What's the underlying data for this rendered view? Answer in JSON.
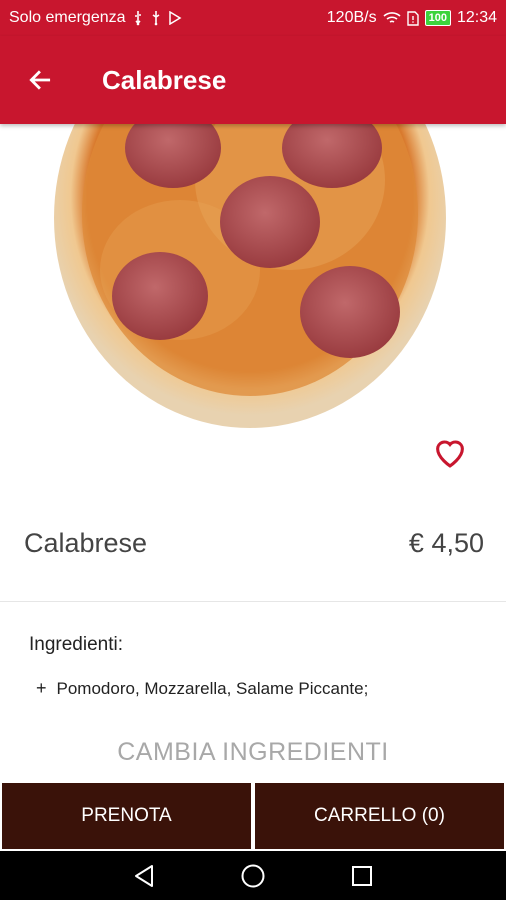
{
  "status_bar": {
    "carrier": "Solo emergenza",
    "speed": "120B/s",
    "battery": "100",
    "time": "12:34"
  },
  "app_bar": {
    "title": "Calabrese",
    "back_icon": "arrow-left-icon"
  },
  "product": {
    "name": "Calabrese",
    "price": "€ 4,50",
    "favorite_icon": "heart-outline-icon",
    "accent_color": "#c8162e"
  },
  "ingredients": {
    "title": "Ingredienti:",
    "items": [
      {
        "prefix": "+",
        "text": "Pomodoro, Mozzarella, Salame Piccante;"
      }
    ]
  },
  "change_ingredients_label": "CAMBIA INGREDIENTI",
  "buttons": {
    "book": "PRENOTA",
    "cart": "CARRELLO (0)",
    "color": "#3a1209"
  },
  "nav": {
    "back": "triangle-back-icon",
    "home": "circle-home-icon",
    "recents": "square-recents-icon"
  }
}
